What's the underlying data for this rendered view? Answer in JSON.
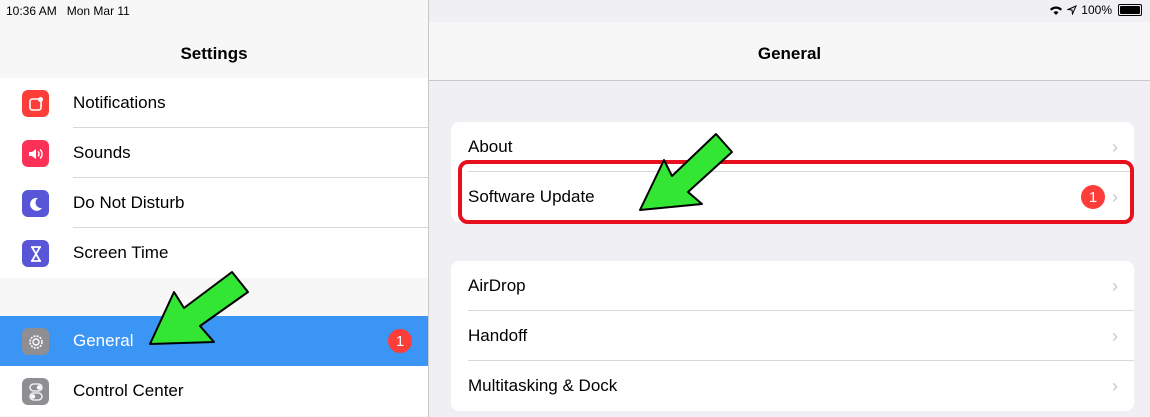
{
  "status_bar": {
    "time": "10:36 AM",
    "date": "Mon Mar 11",
    "battery": "100%"
  },
  "sidebar": {
    "title": "Settings",
    "group1": [
      {
        "label": "Notifications",
        "icon": "notifications-icon",
        "color": "#fc3d39"
      },
      {
        "label": "Sounds",
        "icon": "sounds-icon",
        "color": "#fc3158"
      },
      {
        "label": "Do Not Disturb",
        "icon": "moon-icon",
        "color": "#5856d6"
      },
      {
        "label": "Screen Time",
        "icon": "hourglass-icon",
        "color": "#5856d6"
      }
    ],
    "group2": [
      {
        "label": "General",
        "icon": "gear-icon",
        "color": "#8e8e93",
        "badge": "1"
      },
      {
        "label": "Control Center",
        "icon": "toggles-icon",
        "color": "#8e8e93"
      }
    ]
  },
  "content": {
    "title": "General",
    "group1": [
      {
        "label": "About"
      },
      {
        "label": "Software Update",
        "badge": "1"
      }
    ],
    "group2": [
      {
        "label": "AirDrop"
      },
      {
        "label": "Handoff"
      },
      {
        "label": "Multitasking & Dock"
      }
    ]
  },
  "colors": {
    "selected": "#3a95f5",
    "badge": "#fc3d39",
    "highlight": "#e8101e",
    "arrow": "#33e633"
  }
}
